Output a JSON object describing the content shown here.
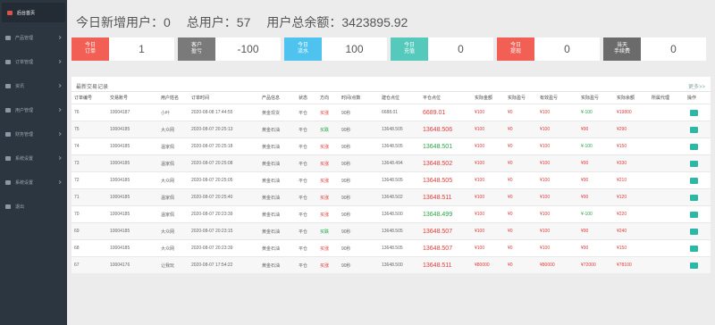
{
  "sidebar": {
    "items": [
      {
        "label": "后台首页",
        "active": true,
        "arrow": false
      },
      {
        "label": "产品管理",
        "active": false,
        "arrow": true
      },
      {
        "label": "订单管理",
        "active": false,
        "arrow": true
      },
      {
        "label": "资讯",
        "active": false,
        "arrow": true
      },
      {
        "label": "用户管理",
        "active": false,
        "arrow": true
      },
      {
        "label": "财务管理",
        "active": false,
        "arrow": true
      },
      {
        "label": "系统设置",
        "active": false,
        "arrow": true
      },
      {
        "label": "系统设置",
        "active": false,
        "arrow": true
      },
      {
        "label": "退出",
        "active": false,
        "arrow": false
      }
    ]
  },
  "summary": {
    "new_users": "今日新增用户：0",
    "total_users": "总用户：57",
    "total_balance": "用户总余额：3423895.92"
  },
  "stats": [
    {
      "label": "今日\n订单",
      "value": "1",
      "color": "#f26055"
    },
    {
      "label": "客户\n盈亏",
      "value": "-100",
      "color": "#7a7a7a"
    },
    {
      "label": "今日\n流水",
      "value": "100",
      "color": "#4fc3f0"
    },
    {
      "label": "今日\n充值",
      "value": "0",
      "color": "#56c9bd"
    },
    {
      "label": "今日\n提现",
      "value": "0",
      "color": "#f26055"
    },
    {
      "label": "当天\n手续费",
      "value": "0",
      "color": "#6b6b6b"
    }
  ],
  "table": {
    "title": "最新交易记录",
    "more": "更多>>",
    "headers": [
      "订单编号",
      "交易账号",
      "用户姓名",
      "订单时间",
      "产品信息",
      "状态",
      "方向",
      "时间/点数",
      "建仓点位",
      "平仓点位",
      "实际金额",
      "实际盈亏",
      "有效盈亏",
      "实际盈亏",
      "实际余额",
      "所属代理",
      "操作"
    ],
    "rows": [
      [
        "76",
        "10004187",
        "小叶",
        "2020-08-08 17:44:55",
        "黄金现货",
        "平仓",
        "买涨",
        "90秒",
        "6688.01",
        "6689.01",
        "¥100",
        "¥0",
        "¥100",
        "¥-100",
        "¥19800",
        ""
      ],
      [
        "75",
        "10004185",
        "大众网",
        "2020-08-07 20:25:13",
        "黄金石油",
        "平仓",
        "买跌",
        "90秒",
        "13648.505",
        "13648.506",
        "¥100",
        "¥0",
        "¥100",
        "¥90",
        "¥290",
        ""
      ],
      [
        "74",
        "10004185",
        "温家佩",
        "2020-08-07 20:25:18",
        "黄金石油",
        "平仓",
        "买涨",
        "90秒",
        "13648.505",
        "13648.501",
        "¥100",
        "¥0",
        "¥100",
        "¥-100",
        "¥150",
        ""
      ],
      [
        "73",
        "10004185",
        "温家佩",
        "2020-08-07 20:25:08",
        "黄金石油",
        "平仓",
        "买涨",
        "90秒",
        "13648.494",
        "13648.502",
        "¥100",
        "¥0",
        "¥100",
        "¥90",
        "¥330",
        ""
      ],
      [
        "72",
        "10004185",
        "大众网",
        "2020-08-07 20:25:05",
        "黄金石油",
        "平仓",
        "买涨",
        "90秒",
        "13648.505",
        "13648.505",
        "¥100",
        "¥0",
        "¥100",
        "¥90",
        "¥210",
        ""
      ],
      [
        "71",
        "10004185",
        "温家佩",
        "2020-08-07 20:25:40",
        "黄金石油",
        "平仓",
        "买涨",
        "90秒",
        "13648.502",
        "13648.511",
        "¥100",
        "¥0",
        "¥100",
        "¥90",
        "¥120",
        ""
      ],
      [
        "70",
        "10004185",
        "温家佩",
        "2020-08-07 20:23:39",
        "黄金石油",
        "平仓",
        "买涨",
        "90秒",
        "13648.500",
        "13648.499",
        "¥100",
        "¥0",
        "¥100",
        "¥-100",
        "¥220",
        ""
      ],
      [
        "69",
        "10004185",
        "大众网",
        "2020-08-07 20:23:15",
        "黄金石油",
        "平仓",
        "买跌",
        "90秒",
        "13648.505",
        "13648.507",
        "¥100",
        "¥0",
        "¥100",
        "¥90",
        "¥240",
        ""
      ],
      [
        "68",
        "10004185",
        "大众网",
        "2020-08-07 20:23:39",
        "黄金石油",
        "平仓",
        "买涨",
        "90秒",
        "13648.505",
        "13648.507",
        "¥100",
        "¥0",
        "¥100",
        "¥90",
        "¥150",
        ""
      ],
      [
        "67",
        "10004176",
        "让我玩",
        "2020-08-07 17:54:22",
        "黄金石油",
        "平仓",
        "买涨",
        "90秒",
        "13648.500",
        "13648.511",
        "¥80000",
        "¥0",
        "¥80000",
        "¥72000",
        "¥78100",
        ""
      ]
    ]
  },
  "colors": {
    "sidebar_bg": "#2b3640",
    "accent_red": "#e33b3b",
    "accent_green": "#27a84a",
    "action_teal": "#2bb9a5"
  }
}
